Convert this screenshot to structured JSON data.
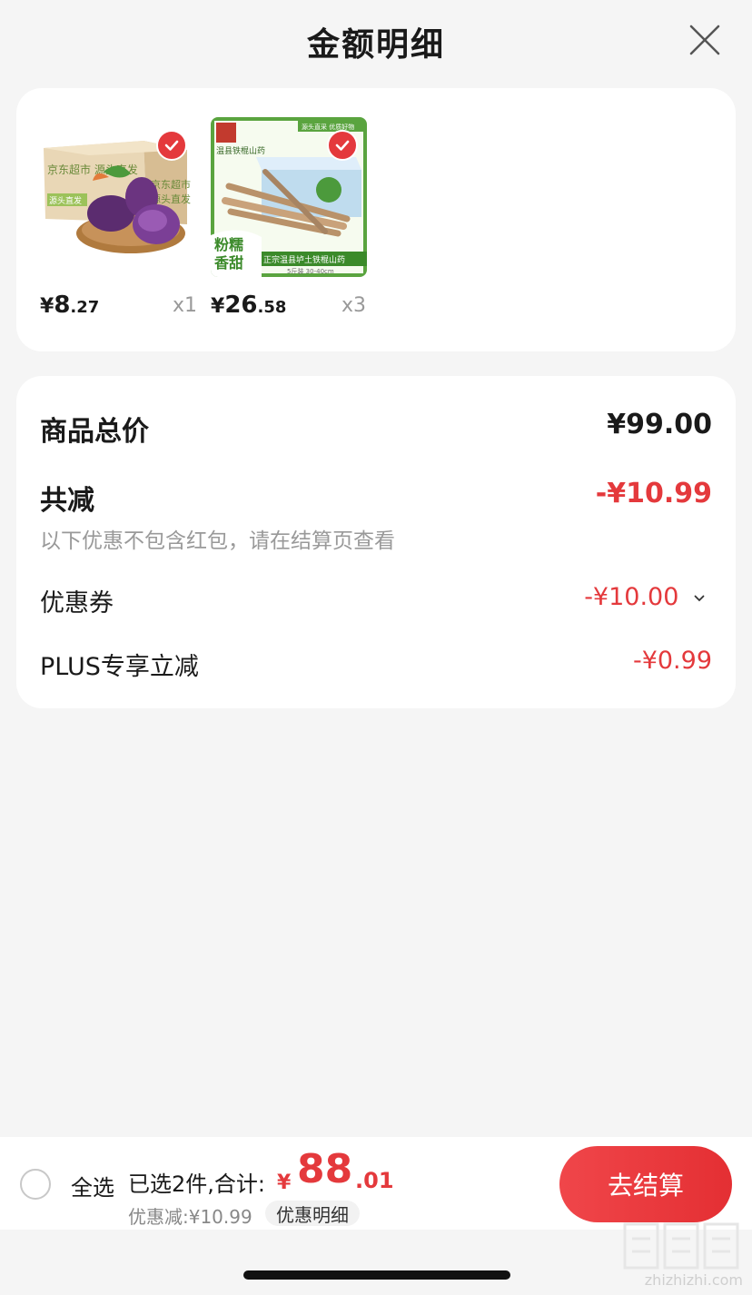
{
  "header": {
    "title": "金额明细"
  },
  "products": [
    {
      "price_symbol": "¥",
      "price_int": "8",
      "price_cents": ".27",
      "qty": "x1",
      "box_text_1": "京东超市 源头直发",
      "box_text_2": "京东超市",
      "box_text_3": "源头直发",
      "box_tag": "源头直发"
    },
    {
      "price_symbol": "¥",
      "price_int": "26",
      "price_cents": ".58",
      "qty": "x3",
      "top_badge": "源头直采 优质好物",
      "brand_text": "温县铁棍山药",
      "corner_badge_1": "粉糯",
      "corner_badge_2": "香甜",
      "banner_text": "正宗温县垆土铁棍山药",
      "banner_sub": "5斤装 30-40cm"
    }
  ],
  "summary": {
    "total_label": "商品总价",
    "total_value": "¥99.00",
    "reduce_label": "共减",
    "reduce_value": "-¥10.99",
    "note": "以下优惠不包含红包，请在结算页查看",
    "coupon_label": "优惠券",
    "coupon_value": "-¥10.00",
    "plus_label": "PLUS专享立减",
    "plus_value": "-¥0.99"
  },
  "bottom": {
    "select_all": "全选",
    "selected_text": "已选2件,合计:",
    "total_symbol": "¥",
    "total_int": "88",
    "total_dec": ".01",
    "discount_text": "优惠减:¥10.99",
    "detail_chip": "优惠明细",
    "checkout": "去结算"
  },
  "watermark": {
    "text": "zhizhizhi.com"
  },
  "colors": {
    "accent": "#e4393c",
    "background": "#f5f5f5",
    "card": "#ffffff",
    "muted": "#999999"
  },
  "icons": {
    "close": "close-icon",
    "check": "check-icon",
    "chevron": "chevron-down-icon",
    "radio": "radio-unchecked-icon"
  }
}
